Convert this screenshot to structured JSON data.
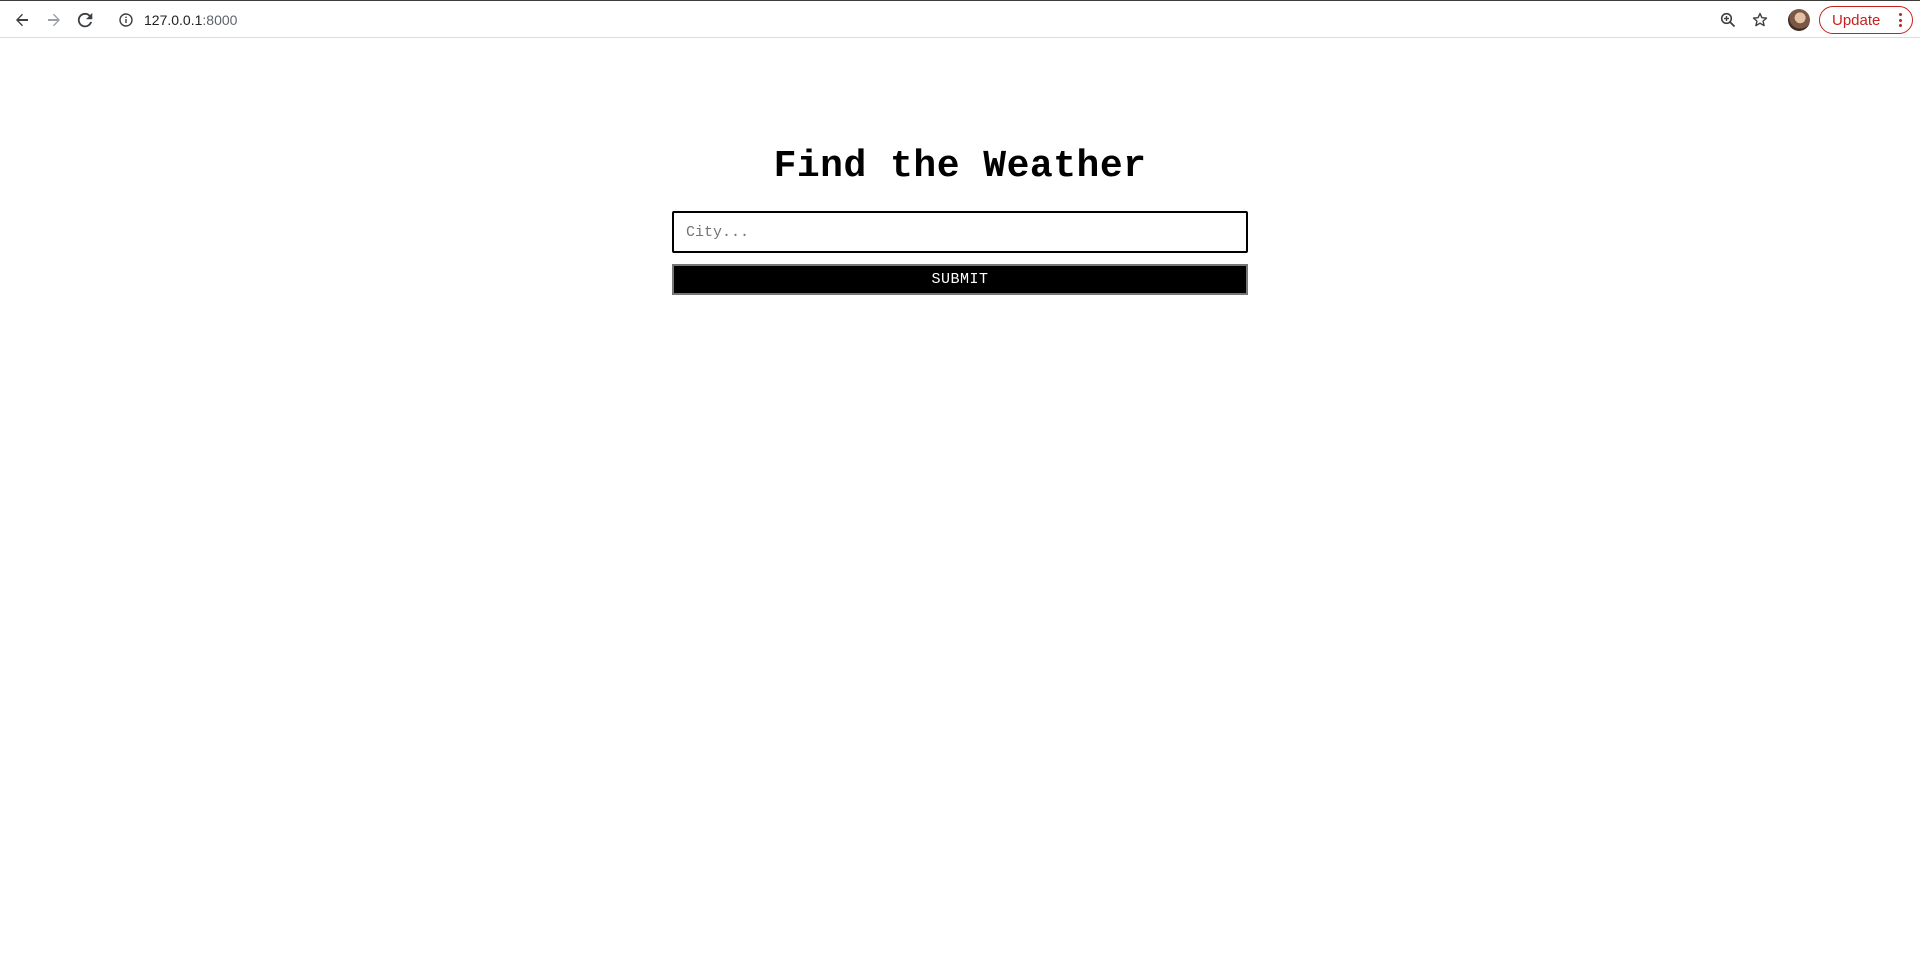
{
  "browser": {
    "url_host": "127.0.0.1",
    "url_port": ":8000",
    "update_label": "Update",
    "icons": [
      "back-arrow-icon",
      "forward-arrow-icon",
      "reload-icon",
      "info-icon",
      "zoom-icon",
      "star-icon",
      "avatar",
      "more-vert-icon"
    ]
  },
  "page": {
    "title": "Find the Weather",
    "city_placeholder": "City...",
    "submit_label": "SUBMIT"
  },
  "colors": {
    "update_accent": "#c5221f",
    "button_bg": "#000000",
    "button_text": "#ffffff"
  }
}
